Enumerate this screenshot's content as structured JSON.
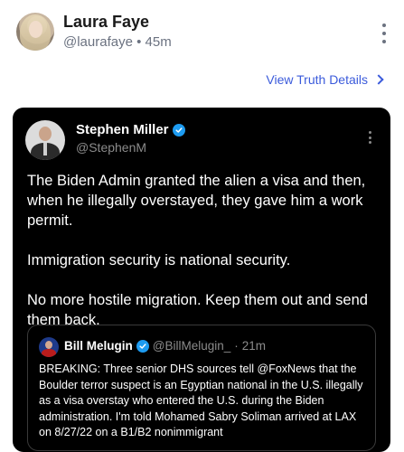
{
  "post": {
    "author_name": "Laura Faye",
    "author_handle": "@laurafaye",
    "separator": "•",
    "time_ago": "45m",
    "view_details_label": "View Truth Details"
  },
  "embed": {
    "author_name": "Stephen Miller",
    "author_handle": "@StephenM",
    "paragraphs": [
      "The Biden Admin granted the alien a visa and then, when he illegally overstayed, they gave him a work permit.",
      "Immigration security is national security.",
      "No more hostile migration. Keep them out and send them back."
    ],
    "quote": {
      "author_name": "Bill Melugin",
      "author_handle": "@BillMelugin_",
      "separator": "·",
      "time_ago": "21m",
      "text": "BREAKING: Three senior DHS sources tell @FoxNews that the Boulder terror suspect is an Egyptian national in the U.S. illegally as a visa overstay who entered the U.S. during the Biden administration. I'm told Mohamed Sabry Soliman arrived at LAX on 8/27/22 on a B1/B2 nonimmigrant"
    }
  },
  "colors": {
    "accent_link": "#3b5bdb",
    "verified_badge": "#1d9bf0",
    "embed_background": "#000000"
  },
  "icons": [
    "more-vertical-icon",
    "chevron-right-icon",
    "verified-badge-icon"
  ]
}
